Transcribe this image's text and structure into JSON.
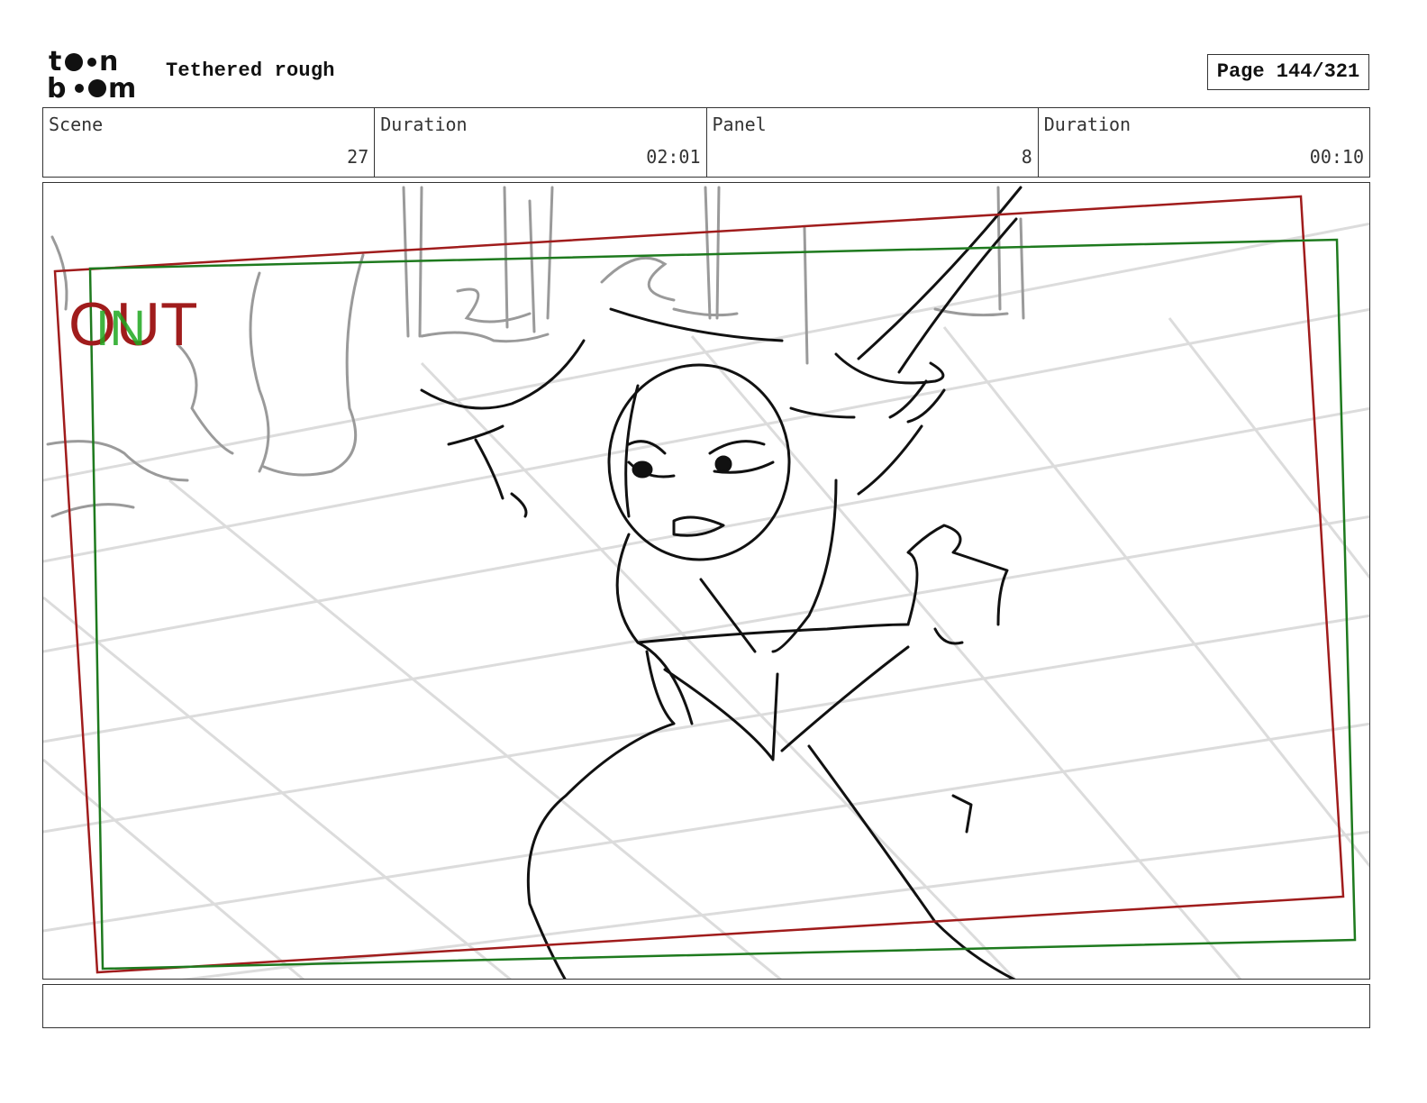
{
  "header": {
    "logo_text": "toon boom",
    "title": "Tethered rough",
    "page": "Page 144/321"
  },
  "info": {
    "scene_label": "Scene",
    "scene_value": "27",
    "scene_duration_label": "Duration",
    "scene_duration_value": "02:01",
    "panel_label": "Panel",
    "panel_value": "8",
    "panel_duration_label": "Duration",
    "panel_duration_value": "00:10"
  },
  "panel": {
    "camera_out_label": "OUT",
    "camera_in_label": "IN",
    "colors": {
      "out_frame": "#a01c1c",
      "in_frame": "#1e7a1e",
      "sketch": "#111111",
      "background_sketch": "#9a9a9a",
      "floor_grid": "#dcdcdc"
    }
  },
  "notes": {
    "text": ""
  }
}
